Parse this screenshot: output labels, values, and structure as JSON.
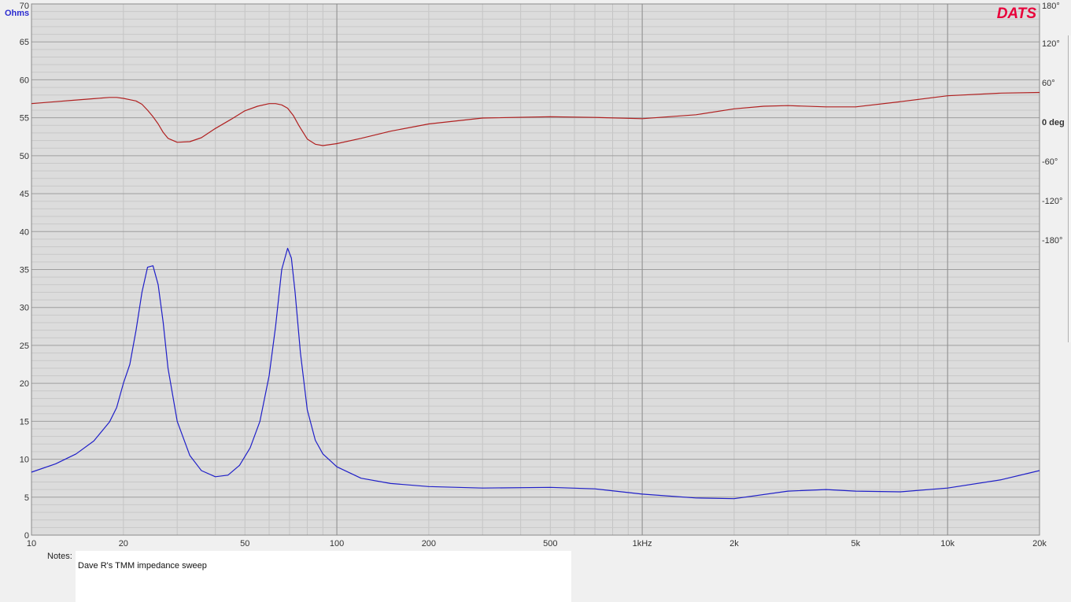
{
  "chart_data": {
    "type": "line",
    "brand": "DATS",
    "xaxis": {
      "scale": "log",
      "range": [
        10,
        20000
      ],
      "ticks": [
        {
          "value": 10,
          "label": "10"
        },
        {
          "value": 20,
          "label": "20"
        },
        {
          "value": 50,
          "label": "50"
        },
        {
          "value": 100,
          "label": "100"
        },
        {
          "value": 200,
          "label": "200"
        },
        {
          "value": 500,
          "label": "500"
        },
        {
          "value": 1000,
          "label": "1kHz"
        },
        {
          "value": 2000,
          "label": "2k"
        },
        {
          "value": 5000,
          "label": "5k"
        },
        {
          "value": 10000,
          "label": "10k"
        },
        {
          "value": 20000,
          "label": "20k"
        }
      ]
    },
    "yaxis_left": {
      "label": "Ohms",
      "range": [
        0,
        70
      ],
      "ticks": [
        "0",
        "5",
        "10",
        "15",
        "20",
        "25",
        "30",
        "35",
        "40",
        "45",
        "50",
        "55",
        "60",
        "65",
        "70"
      ]
    },
    "yaxis_right": {
      "label": "0 deg",
      "range": [
        -630,
        180
      ],
      "ticks": [
        {
          "value": 180,
          "label": "180°"
        },
        {
          "value": 120,
          "label": "120°"
        },
        {
          "value": 60,
          "label": "60°"
        },
        {
          "value": 0,
          "label": "0 deg"
        },
        {
          "value": -60,
          "label": "-60°"
        },
        {
          "value": -120,
          "label": "-120°"
        },
        {
          "value": -180,
          "label": "-180°"
        }
      ]
    },
    "grid": true,
    "series": [
      {
        "axis": "left",
        "color": "#1f1fc8",
        "x": [
          10,
          12,
          14,
          16,
          18,
          19,
          20,
          21,
          22,
          23,
          24,
          25,
          26,
          27,
          28,
          30,
          33,
          36,
          40,
          44,
          48,
          52,
          56,
          60,
          63,
          66,
          69,
          71,
          73,
          76,
          80,
          85,
          90,
          100,
          120,
          150,
          200,
          300,
          500,
          700,
          1000,
          1500,
          2000,
          3000,
          4000,
          5000,
          7000,
          10000,
          15000,
          20000
        ],
        "y": [
          8.3,
          9.4,
          10.7,
          12.4,
          14.9,
          16.8,
          20,
          22.5,
          27,
          32,
          35.3,
          35.5,
          33,
          28,
          22,
          15,
          10.5,
          8.5,
          7.7,
          7.9,
          9.2,
          11.5,
          15,
          21,
          27.5,
          35,
          37.8,
          36.5,
          32,
          24,
          16.5,
          12.5,
          10.7,
          9,
          7.5,
          6.8,
          6.4,
          6.2,
          6.3,
          6.1,
          5.4,
          4.9,
          4.8,
          5.8,
          6,
          5.8,
          5.7,
          6.2,
          7.3,
          8.5
        ]
      },
      {
        "axis": "right",
        "color": "#b02020",
        "x": [
          10,
          12,
          14,
          16,
          18,
          19,
          20,
          21,
          22,
          23,
          24,
          25,
          26,
          27,
          28,
          30,
          33,
          36,
          40,
          45,
          50,
          55,
          60,
          63,
          66,
          69,
          72,
          75,
          80,
          85,
          90,
          100,
          120,
          150,
          200,
          300,
          500,
          700,
          1000,
          1500,
          2000,
          2500,
          3000,
          4000,
          5000,
          7000,
          10000,
          15000,
          20000
        ],
        "y": [
          28,
          31,
          33.5,
          35.5,
          37.5,
          37.5,
          36,
          34,
          32,
          27,
          18,
          8,
          -3,
          -16,
          -25,
          -31,
          -30,
          -24,
          -10,
          4,
          17,
          24,
          28,
          28,
          26,
          21,
          10,
          -5,
          -26,
          -34,
          -36,
          -33,
          -25,
          -14,
          -3,
          6,
          8,
          7,
          5,
          11,
          20,
          24,
          25,
          23,
          23,
          31,
          40,
          44,
          45
        ]
      }
    ]
  },
  "notes": {
    "label": "Notes:",
    "text": "Dave R's TMM impedance sweep"
  }
}
